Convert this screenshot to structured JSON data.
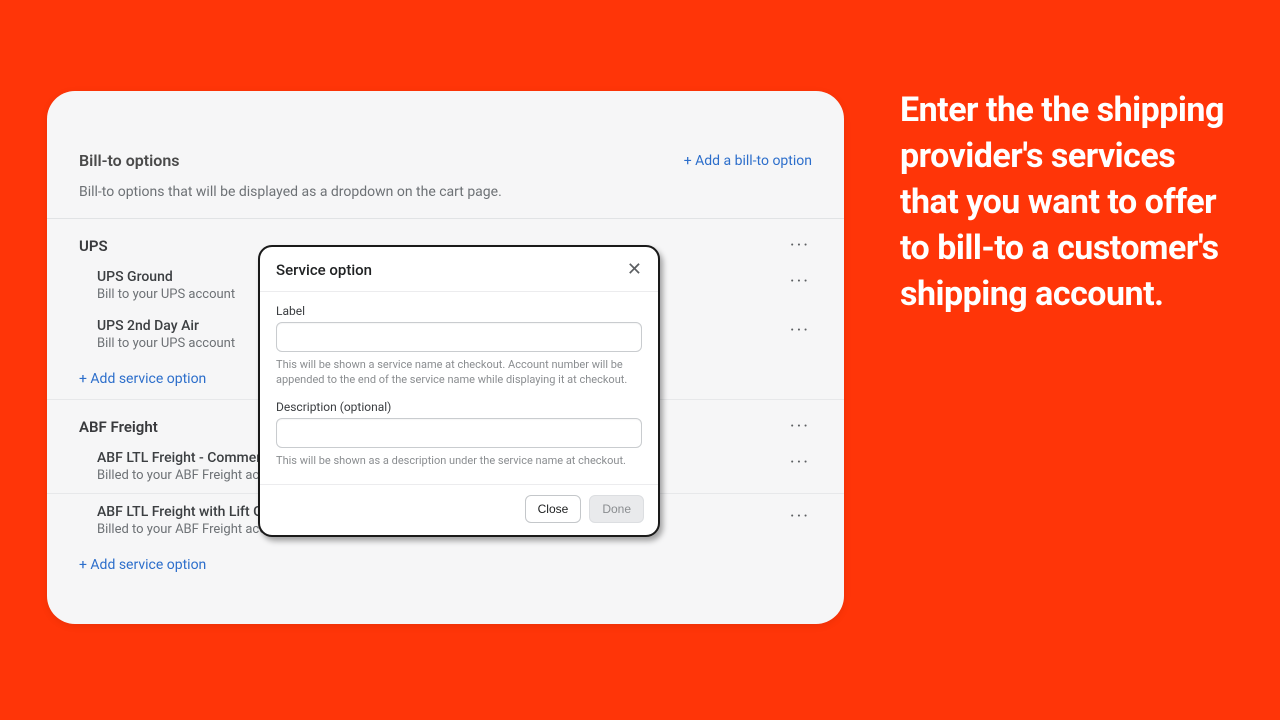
{
  "promo_text": "Enter the the shipping provider's services that you want to offer to bill-to a customer's shipping account.",
  "panel": {
    "title": "Bill-to options",
    "subtitle": "Bill-to options that will be displayed as a dropdown on the cart page.",
    "add_link": "+ Add a bill-to option"
  },
  "groups": [
    {
      "name": "UPS",
      "services": [
        {
          "name": "UPS Ground",
          "desc": "Bill to your UPS account"
        },
        {
          "name": "UPS 2nd Day Air",
          "desc": "Bill to your UPS account"
        }
      ],
      "add_label": "+ Add service option"
    },
    {
      "name": "ABF Freight",
      "services": [
        {
          "name": "ABF LTL Freight - Commerical Address",
          "desc": "Billed to your ABF Freight account."
        },
        {
          "name": "ABF LTL Freight with Lift Gate Delivery - Commercial Address",
          "desc": "Billed to your ABF Freight account."
        }
      ],
      "add_label": "+ Add service option"
    }
  ],
  "modal": {
    "title": "Service option",
    "label_field": {
      "label": "Label",
      "help": "This will be shown a service name at checkout. Account number will be appended to the end of the service name while displaying it at checkout."
    },
    "desc_field": {
      "label": "Description (optional)",
      "help": "This will be shown as a description under the service name at checkout."
    },
    "close_btn": "Close",
    "done_btn": "Done"
  }
}
